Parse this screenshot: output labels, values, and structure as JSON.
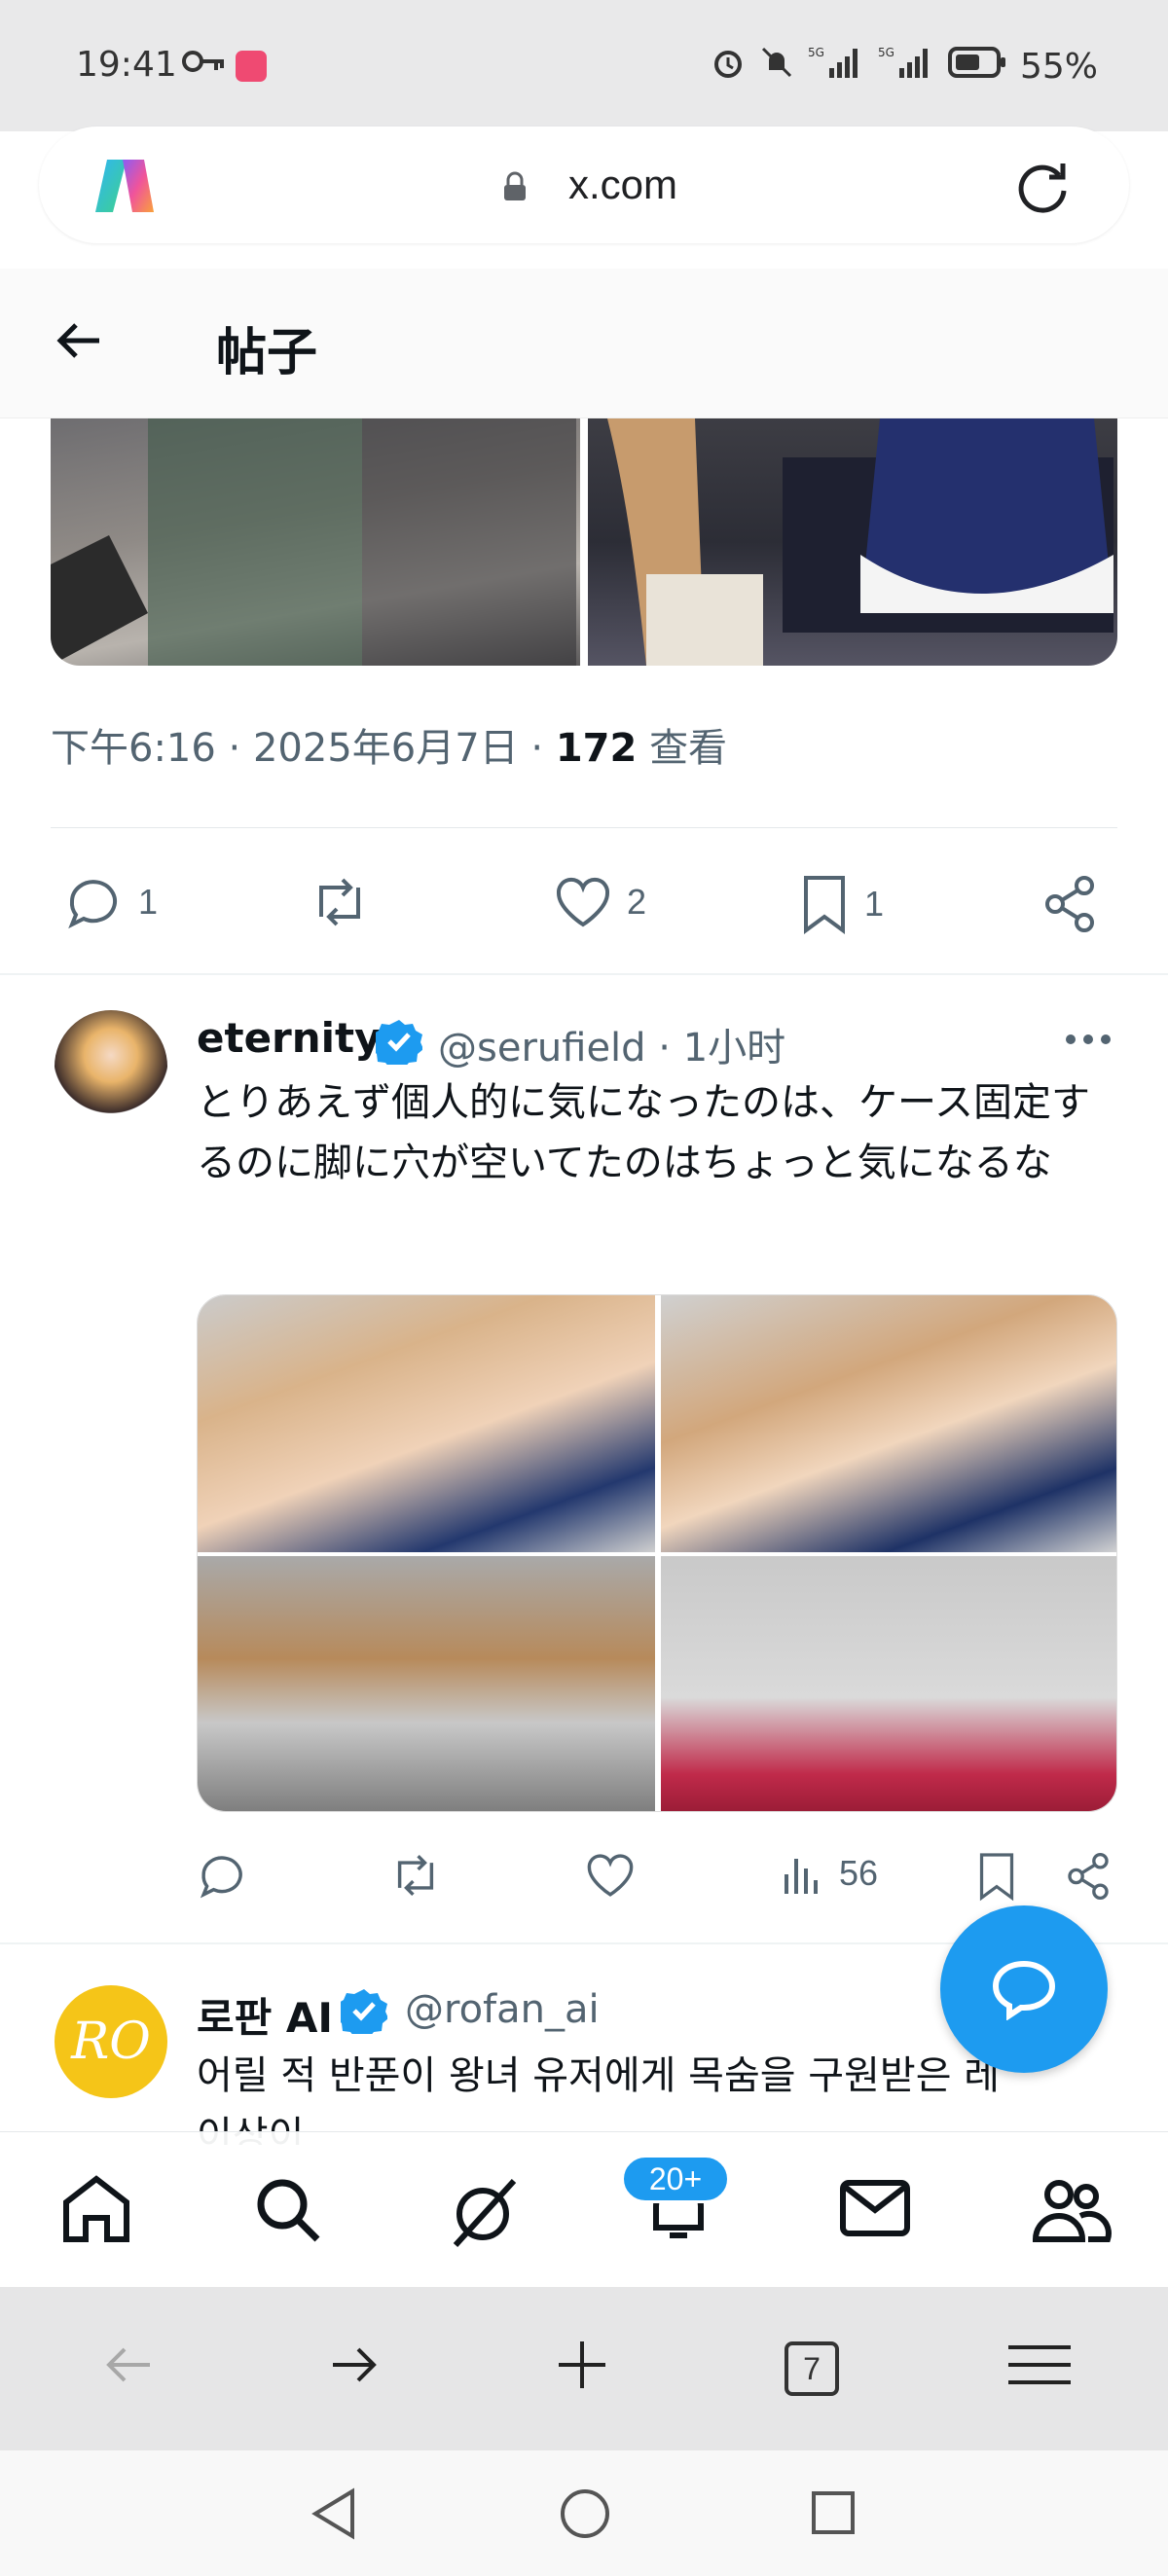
{
  "status_bar": {
    "time": "19:41",
    "battery": "55%",
    "signal1": "5G",
    "signal2": "5G"
  },
  "browser": {
    "url": "x.com",
    "tab_count": "7"
  },
  "header": {
    "title": "帖子"
  },
  "main_tweet": {
    "time": "下午6:16",
    "date": "2025年6月7日",
    "views_count": "172",
    "views_label": "查看",
    "replies": "1",
    "likes": "2",
    "bookmarks": "1"
  },
  "reply1": {
    "name": "eternity",
    "handle": "@serufield",
    "time": "1小时",
    "text": "とりあえず個人的に気になったのは、ケース固定するのに脚に穴が空いてたのはちょっと気になるな",
    "views": "56"
  },
  "reply2": {
    "name": "로판 AI",
    "handle": "@rofan_ai",
    "avatar_text": "RO",
    "text_line1": "어릴 적 반푼이 왕녀 유저에게 목숨을 구원받은 레",
    "text_line2": "이상이"
  },
  "tabbar": {
    "notification_badge": "20+"
  },
  "colors": {
    "accent": "#1d9bf0",
    "text": "#0f1419",
    "secondary": "#536471"
  }
}
